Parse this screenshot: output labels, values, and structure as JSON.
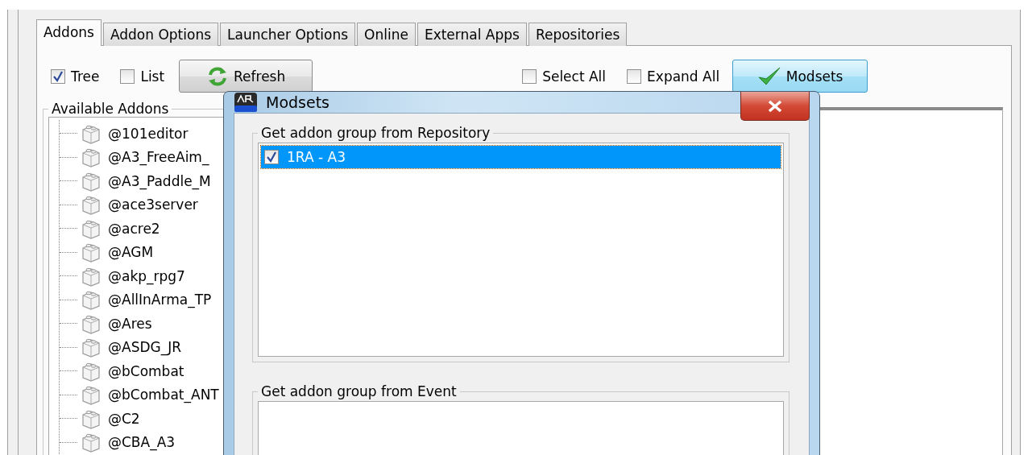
{
  "tabs": [
    {
      "label": "Addons",
      "selected": true
    },
    {
      "label": "Addon Options",
      "selected": false
    },
    {
      "label": "Launcher Options",
      "selected": false
    },
    {
      "label": "Online",
      "selected": false
    },
    {
      "label": "External Apps",
      "selected": false
    },
    {
      "label": "Repositories",
      "selected": false
    }
  ],
  "toolbar": {
    "view_options": [
      {
        "label": "Tree",
        "checked": true
      },
      {
        "label": "List",
        "checked": false
      }
    ],
    "refresh_button": {
      "label": "Refresh"
    },
    "select_options": [
      {
        "label": "Select All",
        "checked": false
      },
      {
        "label": "Expand All",
        "checked": false
      }
    ],
    "modsets_button": {
      "label": "Modsets"
    }
  },
  "available_addons": {
    "title": "Available Addons",
    "items": [
      "@101editor",
      "@A3_FreeAim_",
      "@A3_Paddle_M",
      "@ace3server",
      "@acre2",
      "@AGM",
      "@akp_rpg7",
      "@AllInArma_TP",
      "@Ares",
      "@ASDG_JR",
      "@bCombat",
      "@bCombat_ANT",
      "@C2",
      "@CBA_A3"
    ]
  },
  "dialog": {
    "title": "Modsets",
    "groups": [
      {
        "title": "Get addon group from Repository",
        "items": [
          {
            "label": "1RA - A3",
            "checked": true,
            "selected": true
          }
        ]
      },
      {
        "title": "Get addon group from Event"
      }
    ]
  }
}
